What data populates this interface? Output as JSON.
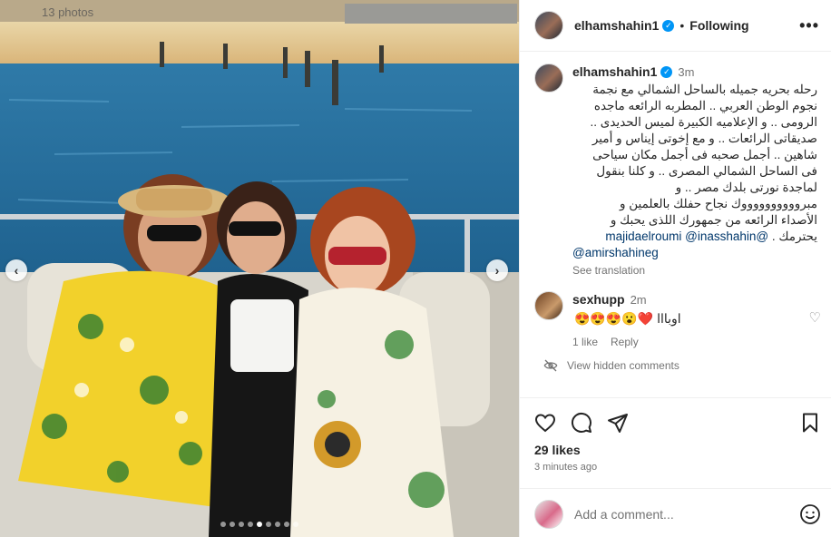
{
  "post": {
    "photo_count": "13 photos",
    "carousel": {
      "count": 9,
      "active_index": 4
    }
  },
  "header": {
    "username": "elhamshahin1",
    "separator": "•",
    "follow_state": "Following",
    "more_icon": "more-horizontal-icon"
  },
  "caption": {
    "username": "elhamshahin1",
    "time": "3m",
    "lines": [
      "رحله بحريه جميله بالساحل الشمالي مع نجمة",
      "نجوم الوطن العربي .. المطربه الرائعه ماجده",
      "الرومى .. و الإعلاميه الكبيرة لميس الحديدى ..",
      "صديقاتى الرائعات .. و مع إخوتى إيناس و أمير",
      "شاهين .. أجمل صحبه فى أجمل مكان سياحى",
      "فى الساحل الشمالي المصرى .. و كلنا بنقول",
      "لماجدة نورتى بلدك مصر .. و",
      "مبرووووووووووك نجاح حفلك بالعلمين و",
      "الأصداء الرائعه من جمهورك اللذى يحبك و",
      "يحترمك ."
    ],
    "mentions": [
      "@majidaelroumi",
      "@inasshahin",
      "@amirshahineg"
    ],
    "see_translation": "See translation"
  },
  "comment": {
    "username": "sexhupp",
    "time": "2m",
    "text": "اوبااا",
    "emojis": "❤️😮😍😍😍",
    "likes": "1 like",
    "reply": "Reply"
  },
  "hidden_comments": "View hidden comments",
  "actions": {
    "likes": "29 likes",
    "timestamp": "3 minutes ago"
  },
  "add_comment": {
    "placeholder": "Add a comment..."
  },
  "colors": {
    "verified": "#0095f6",
    "mention": "#00376b",
    "secondary_text": "#737373"
  }
}
